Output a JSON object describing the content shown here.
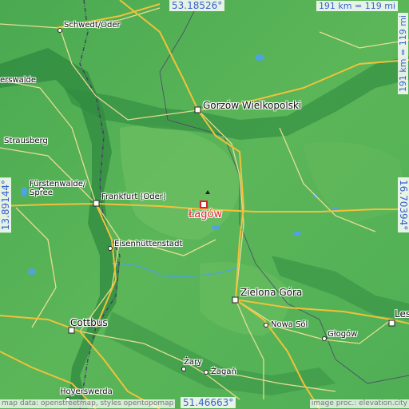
{
  "map": {
    "colors": {
      "land_light": "#6cbf62",
      "land_mid": "#4aa951",
      "land_dark": "#2f8a3f",
      "valley": "#2d7c3a",
      "road_major": "#f0c23a",
      "road_minor": "#f6e39a",
      "border": "#4a3b6a",
      "water": "#4fa3e0",
      "target": "#e0202a",
      "coord_text": "#3a5fcd"
    },
    "coordinates": {
      "top": "53.18526°",
      "bottom": "51.46663°",
      "left": "13.89144°",
      "right": "16.70394°"
    },
    "scale": {
      "horizontal": "191 km = 119 mi",
      "vertical": "191 km = 119 mi"
    },
    "target": {
      "name": "Łagów"
    },
    "places": [
      {
        "id": "schwedt",
        "name": "Schwedt/Oder"
      },
      {
        "id": "erswalde",
        "name": "erswalde"
      },
      {
        "id": "gorzow",
        "name": "Gorzów Wielkopolski"
      },
      {
        "id": "strausberg",
        "name": "Strausberg"
      },
      {
        "id": "furstenwalde1",
        "name": "Fürstenwalde/"
      },
      {
        "id": "furstenwalde2",
        "name": "Spree"
      },
      {
        "id": "frankfurt",
        "name": "Frankfurt (Oder)"
      },
      {
        "id": "eisen",
        "name": "Eisenhüttenstadt"
      },
      {
        "id": "zielona",
        "name": "Zielona Góra"
      },
      {
        "id": "nowasol",
        "name": "Nowa Sól"
      },
      {
        "id": "cottbus",
        "name": "Cottbus"
      },
      {
        "id": "glogow",
        "name": "Głogów"
      },
      {
        "id": "zary",
        "name": "Żary"
      },
      {
        "id": "zagan",
        "name": "Żagań"
      },
      {
        "id": "les",
        "name": "Les"
      },
      {
        "id": "hoyers",
        "name": "Hoyerswerda"
      }
    ],
    "credits": {
      "left": "map data: openstreetmap, styles opentopomap",
      "right": "image proc.: elevation.city"
    }
  }
}
